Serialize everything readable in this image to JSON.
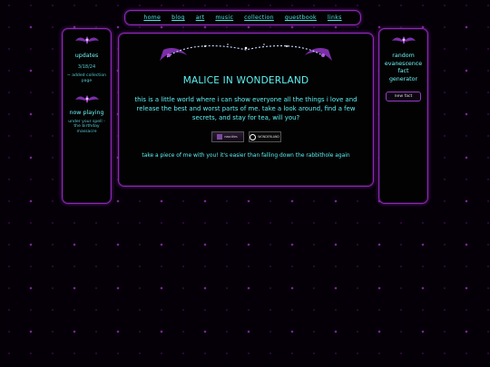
{
  "nav": {
    "home": "home",
    "blog": "blog",
    "art": "art",
    "music": "music",
    "collection": "collection",
    "guestbook": "guestbook",
    "links": "links"
  },
  "left": {
    "updates_title": "updates",
    "update_date": "3/18/24",
    "update_text": "~ added collection page",
    "now_playing_title": "now playing",
    "now_playing_text": "under your spell - the birthday massacre"
  },
  "main": {
    "title": "MALICE IN WONDERLAND",
    "intro": "this is a little world where i can show everyone all the things i love and release the best and worst parts of me. take a look around, find a few secrets, and stay for tea, will you?",
    "button1_text": "neocities",
    "button2_text": "WONDERLAND",
    "tagline": "take a piece of me with you! it's easier than falling down the rabbithole again"
  },
  "right": {
    "title": "random evanescence fact generator",
    "button_label": "new fact"
  },
  "colors": {
    "accent_cyan": "#5ff2f2",
    "border_purple": "#8a2ab0",
    "background": "#050008"
  }
}
